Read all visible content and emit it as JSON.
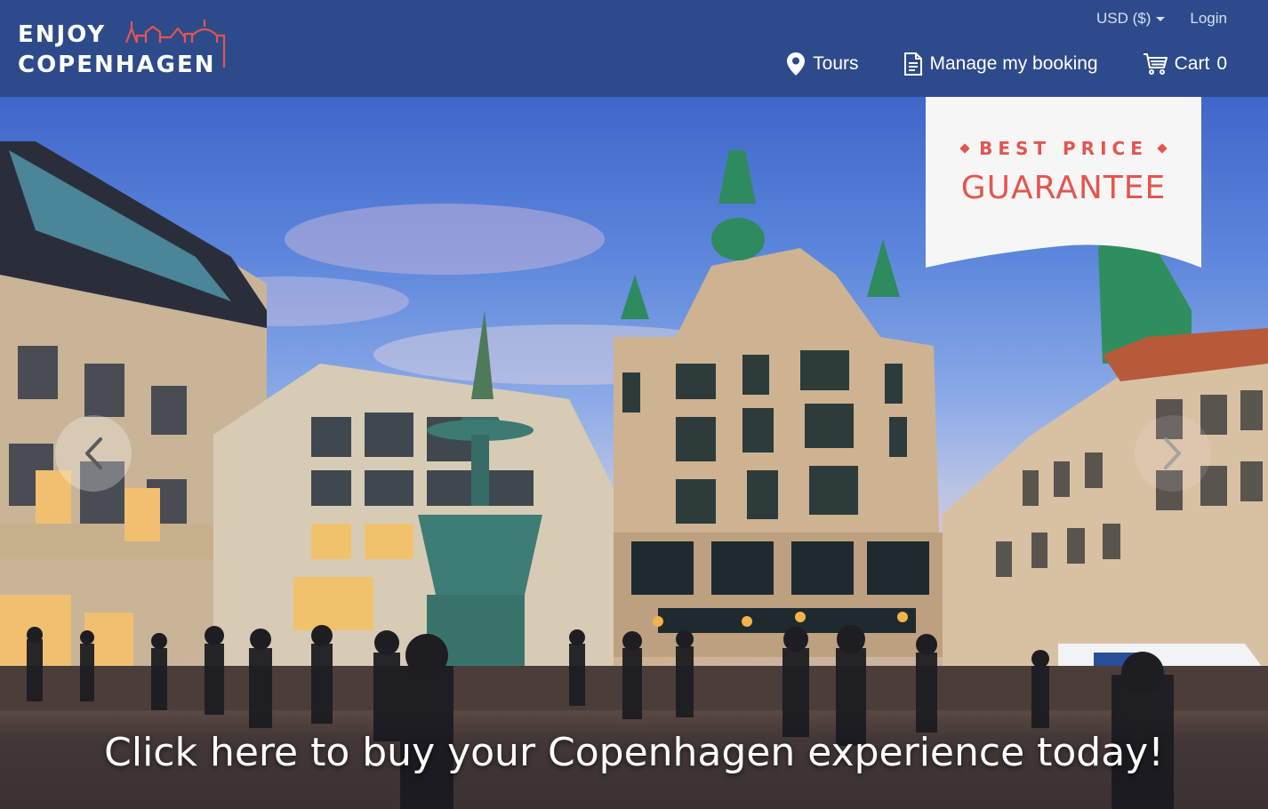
{
  "header": {
    "logo": {
      "line1": "ENJOY",
      "line2": "COPENHAGEN"
    },
    "top_links": {
      "currency": "USD ($)",
      "login": "Login"
    },
    "nav": {
      "tours": "Tours",
      "manage_booking": "Manage my booking",
      "cart_label": "Cart",
      "cart_count": "0"
    }
  },
  "hero": {
    "badge": {
      "top": "BEST PRICE",
      "main": "GUARANTEE"
    },
    "caption": "Click here to buy your Copenhagen experience today!",
    "prev_icon": "chevron-left-icon",
    "next_icon": "chevron-right-icon"
  },
  "colors": {
    "header_bg": "#2d4b8a",
    "accent": "#e5554f",
    "badge_bg": "#f6f6f6"
  }
}
